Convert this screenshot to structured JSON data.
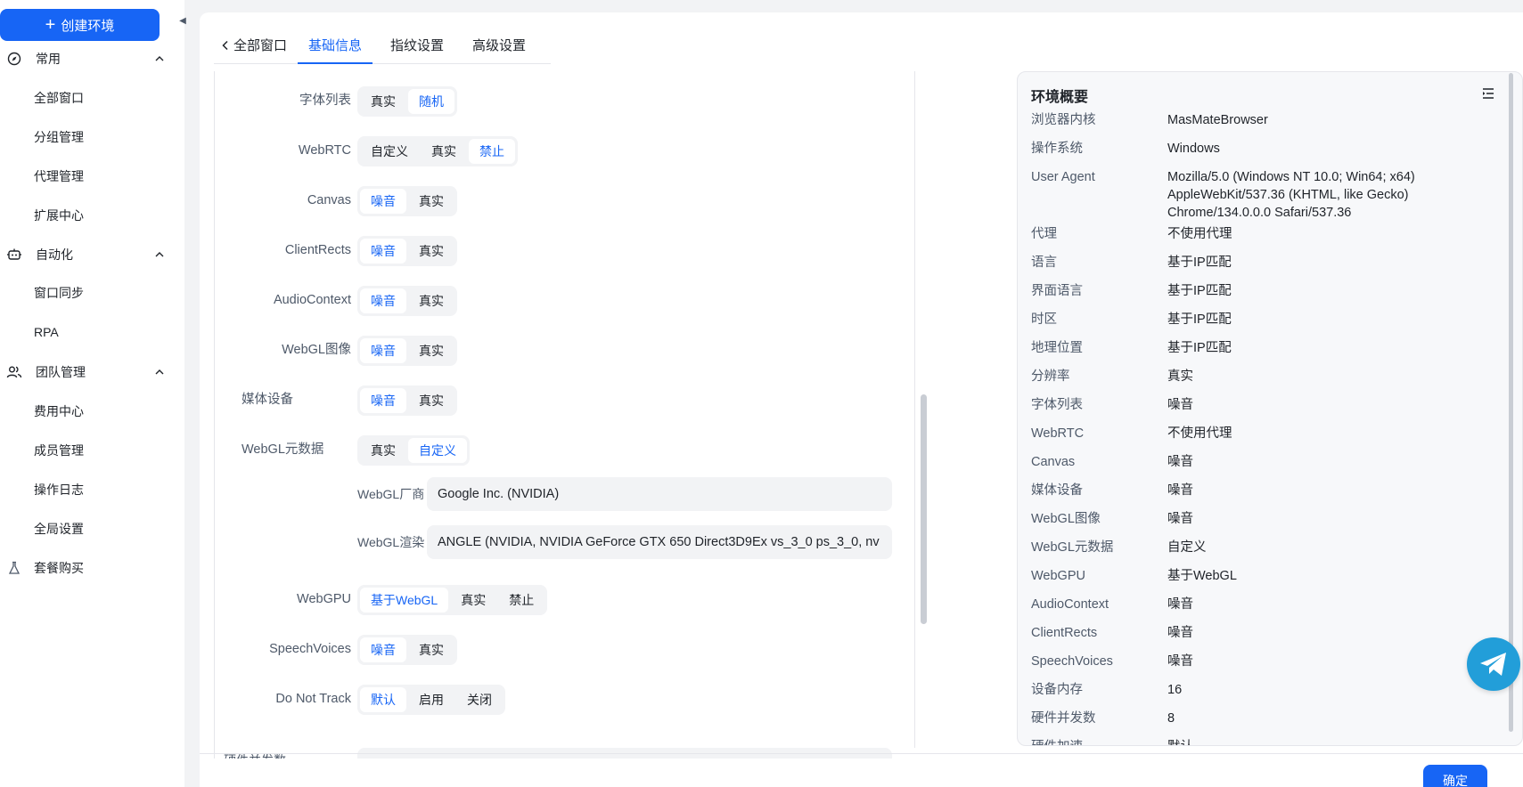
{
  "sidebar": {
    "create_label": "创建环境",
    "groups": [
      {
        "label": "常用",
        "icon": "compass-icon",
        "items": [
          "全部窗口",
          "分组管理",
          "代理管理",
          "扩展中心"
        ]
      },
      {
        "label": "自动化",
        "icon": "robot-icon",
        "items": [
          "窗口同步",
          "RPA"
        ]
      },
      {
        "label": "团队管理",
        "icon": "team-icon",
        "items": [
          "费用中心",
          "成员管理",
          "操作日志",
          "全局设置"
        ]
      }
    ],
    "bottom_item": {
      "label": "套餐购买",
      "icon": "flask-icon"
    }
  },
  "tabs": {
    "back": "全部窗口",
    "items": [
      "基础信息",
      "指纹设置",
      "高级设置"
    ],
    "active": "基础信息"
  },
  "form": {
    "font_list": {
      "label": "字体列表",
      "options": [
        "真实",
        "随机"
      ],
      "selected": "随机"
    },
    "webrtc": {
      "label": "WebRTC",
      "options": [
        "自定义",
        "真实",
        "禁止"
      ],
      "selected": "禁止"
    },
    "canvas": {
      "label": "Canvas",
      "options": [
        "噪音",
        "真实"
      ],
      "selected": "噪音"
    },
    "clientrects": {
      "label": "ClientRects",
      "options": [
        "噪音",
        "真实"
      ],
      "selected": "噪音"
    },
    "audiocontext": {
      "label": "AudioContext",
      "options": [
        "噪音",
        "真实"
      ],
      "selected": "噪音"
    },
    "webgl_image": {
      "label": "WebGL图像",
      "options": [
        "噪音",
        "真实"
      ],
      "selected": "噪音"
    },
    "media": {
      "label": "媒体设备",
      "options": [
        "噪音",
        "真实"
      ],
      "selected": "噪音"
    },
    "webgl_meta": {
      "label": "WebGL元数据",
      "options": [
        "真实",
        "自定义"
      ],
      "selected": "自定义"
    },
    "webgl_vendor": {
      "label": "WebGL厂商",
      "value": "Google Inc. (NVIDIA)"
    },
    "webgl_renderer": {
      "label": "WebGL渲染",
      "value": "ANGLE (NVIDIA, NVIDIA GeForce GTX 650 Direct3D9Ex vs_3_0 ps_3_0, nv"
    },
    "webgpu": {
      "label": "WebGPU",
      "options": [
        "基于WebGL",
        "真实",
        "禁止"
      ],
      "selected": "基于WebGL"
    },
    "speechvoices": {
      "label": "SpeechVoices",
      "options": [
        "噪音",
        "真实"
      ],
      "selected": "噪音"
    },
    "dnt": {
      "label": "Do Not Track",
      "options": [
        "默认",
        "启用",
        "关闭"
      ],
      "selected": "默认"
    },
    "hw_concurrency_label": "硬件并发数"
  },
  "summary": {
    "title": "环境概要",
    "rows": [
      {
        "k": "浏览器内核",
        "v": "MasMateBrowser"
      },
      {
        "k": "操作系统",
        "v": "Windows"
      },
      {
        "k": "User Agent",
        "v": "Mozilla/5.0 (Windows NT 10.0; Win64; x64) AppleWebKit/537.36 (KHTML, like Gecko) Chrome/134.0.0.0 Safari/537.36"
      },
      {
        "k": "代理",
        "v": "不使用代理"
      },
      {
        "k": "语言",
        "v": "基于IP匹配"
      },
      {
        "k": "界面语言",
        "v": "基于IP匹配"
      },
      {
        "k": "时区",
        "v": "基于IP匹配"
      },
      {
        "k": "地理位置",
        "v": "基于IP匹配"
      },
      {
        "k": "分辨率",
        "v": "真实"
      },
      {
        "k": "字体列表",
        "v": "噪音"
      },
      {
        "k": "WebRTC",
        "v": "不使用代理"
      },
      {
        "k": "Canvas",
        "v": "噪音"
      },
      {
        "k": "媒体设备",
        "v": "噪音"
      },
      {
        "k": "WebGL图像",
        "v": "噪音"
      },
      {
        "k": "WebGL元数据",
        "v": "自定义"
      },
      {
        "k": "WebGPU",
        "v": "基于WebGL"
      },
      {
        "k": "AudioContext",
        "v": "噪音"
      },
      {
        "k": "ClientRects",
        "v": "噪音"
      },
      {
        "k": "SpeechVoices",
        "v": "噪音"
      },
      {
        "k": "设备内存",
        "v": "16"
      },
      {
        "k": "硬件并发数",
        "v": "8"
      },
      {
        "k": "硬件加速",
        "v": "默认"
      }
    ]
  },
  "footer": {
    "confirm_label": "确定"
  },
  "colors": {
    "accent": "#1765f5",
    "telegram": "#229ed9"
  }
}
